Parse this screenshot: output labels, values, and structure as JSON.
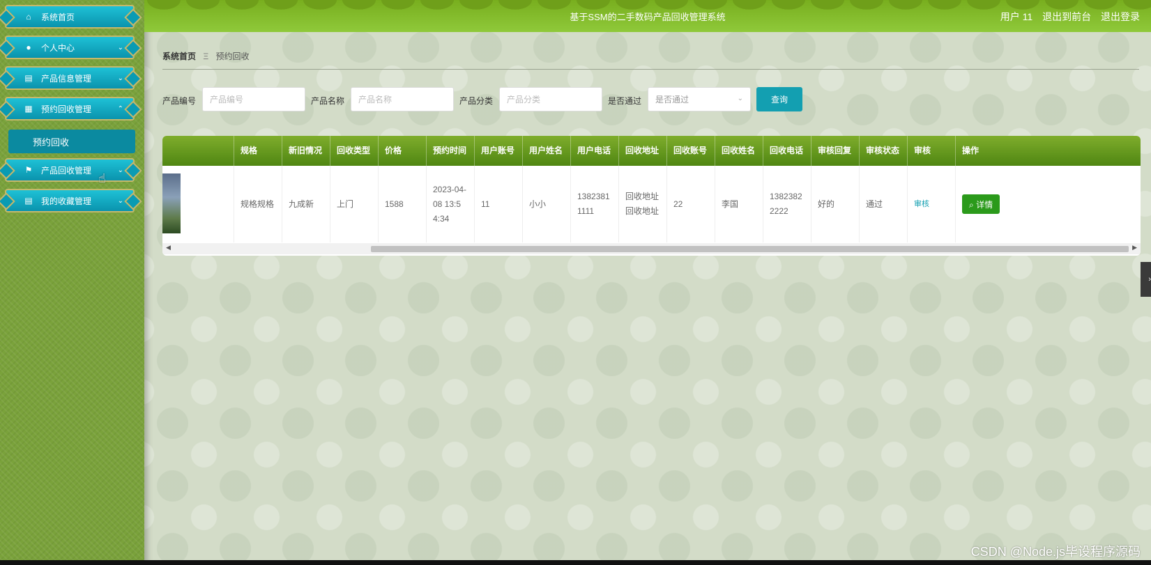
{
  "header": {
    "title": "基于SSM的二手数码产品回收管理系统",
    "user": "用户 11",
    "back_front": "退出到前台",
    "logout": "退出登录"
  },
  "sidebar": {
    "items": [
      {
        "label": "系统首页",
        "icon": "home-icon"
      },
      {
        "label": "个人中心",
        "icon": "user-icon"
      },
      {
        "label": "产品信息管理",
        "icon": "clipboard-icon"
      },
      {
        "label": "预约回收管理",
        "icon": "grid-icon"
      },
      {
        "label": "产品回收管理",
        "icon": "flag-icon"
      },
      {
        "label": "我的收藏管理",
        "icon": "clipboard-icon"
      }
    ],
    "sub_item": "预约回收"
  },
  "breadcrumb": {
    "home": "系统首页",
    "sep": "Ξ",
    "current": "预约回收"
  },
  "search": {
    "f1_label": "产品编号",
    "f1_placeholder": "产品编号",
    "f2_label": "产品名称",
    "f2_placeholder": "产品名称",
    "f3_label": "产品分类",
    "f3_placeholder": "产品分类",
    "f4_label": "是否通过",
    "f4_placeholder": "是否通过",
    "button": "查询"
  },
  "table": {
    "headers": [
      "",
      "规格",
      "新旧情况",
      "回收类型",
      "价格",
      "预约时间",
      "用户账号",
      "用户姓名",
      "用户电话",
      "回收地址",
      "回收账号",
      "回收姓名",
      "回收电话",
      "审核回复",
      "审核状态",
      "审核",
      "操作"
    ],
    "row": {
      "spec": "规格规格",
      "condition": "九成新",
      "type": "上门",
      "price": "1588",
      "time": "2023-04-08 13:54:34",
      "account": "11",
      "name": "小小",
      "phone": "13823811111",
      "address": "回收地址回收地址",
      "r_account": "22",
      "r_name": "李国",
      "r_phone": "13823822222",
      "reply": "好的",
      "status": "通过",
      "audit": "审核",
      "detail": "详情"
    }
  },
  "watermark": "CSDN @Node.js毕设程序源码"
}
